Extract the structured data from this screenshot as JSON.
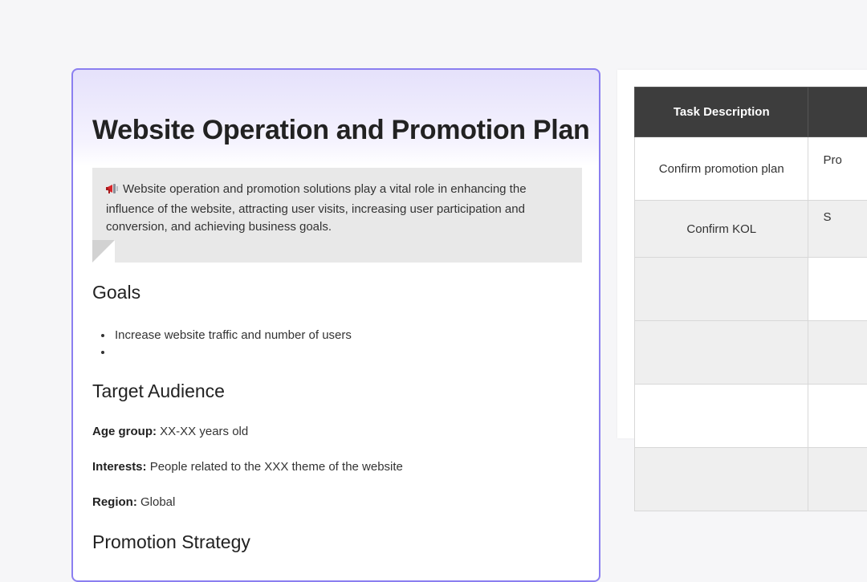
{
  "document": {
    "title": "Website Operation and Promotion Plan",
    "callout": {
      "icon": "megaphone-icon",
      "text": "Website operation and promotion solutions play a vital role in enhancing the influence of the website, attracting user visits, increasing user participation and conversion, and achieving business goals."
    },
    "goals": {
      "heading": "Goals",
      "items": [
        "Increase website traffic and number of users",
        ""
      ]
    },
    "target_audience": {
      "heading": "Target Audience",
      "age_label": "Age group:",
      "age_value": "XX-XX years old",
      "interests_label": "Interests:",
      "interests_value": "People related to the XXX theme of the website",
      "region_label": "Region:",
      "region_value": "Global"
    },
    "promotion_strategy": {
      "heading": "Promotion Strategy"
    }
  },
  "table": {
    "headers": [
      "Task Description",
      ""
    ],
    "rows": [
      [
        "Confirm promotion plan",
        "Pro"
      ],
      [
        "Confirm KOL",
        "S"
      ],
      [
        "",
        ""
      ],
      [
        "",
        ""
      ],
      [
        "",
        ""
      ],
      [
        "",
        ""
      ]
    ]
  },
  "colors": {
    "card_border": "#8b7ff0",
    "header_bg": "#3d3d3d",
    "callout_bg": "#e8e8e8"
  }
}
